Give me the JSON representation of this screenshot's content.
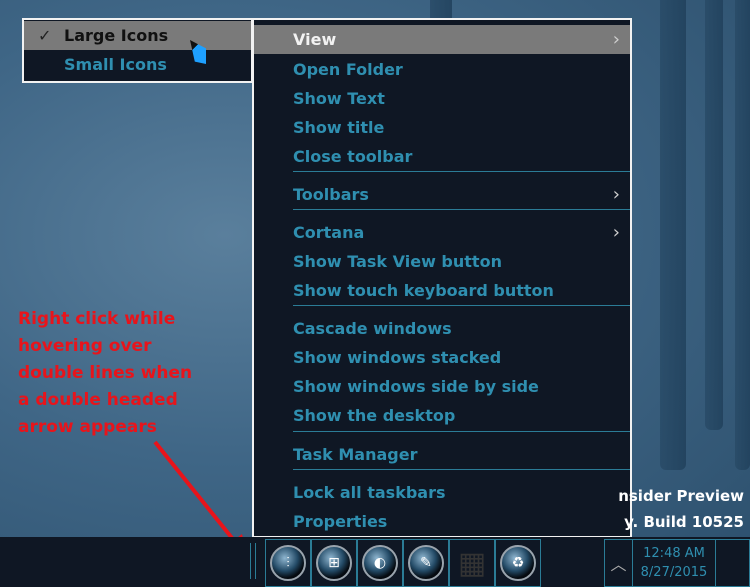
{
  "submenu": {
    "items": [
      {
        "label": "Large Icons",
        "checked": true,
        "highlighted": true
      },
      {
        "label": "Small Icons",
        "checked": false
      }
    ]
  },
  "menu": {
    "items": [
      {
        "label": "View",
        "arrow": true,
        "highlighted": true
      },
      {
        "label": "Open Folder"
      },
      {
        "label": "Show Text"
      },
      {
        "label": "Show title"
      },
      {
        "label": "Close toolbar"
      },
      {
        "label": "Toolbars",
        "arrow": true
      },
      {
        "label": "Cortana",
        "arrow": true
      },
      {
        "label": "Show Task View button"
      },
      {
        "label": "Show touch keyboard button"
      },
      {
        "label": "Cascade windows"
      },
      {
        "label": "Show windows stacked"
      },
      {
        "label": "Show windows side by side"
      },
      {
        "label": "Show the desktop"
      },
      {
        "label": "Task Manager"
      },
      {
        "label": "Lock all taskbars"
      },
      {
        "label": "Properties"
      }
    ]
  },
  "annotation": [
    "Right click while",
    "hovering over",
    "double lines when",
    "a double headed",
    "arrow appears"
  ],
  "watermark": {
    "line1": "nsider Preview",
    "line2": "y. Build 10525"
  },
  "taskbar": {
    "icons": [
      "equalizer-icon",
      "windows-icon",
      "firefox-icon",
      "edit-icon",
      "blocks-icon",
      "recycle-bin-icon"
    ],
    "clock": {
      "time": "12:48 AM",
      "date": "8/27/2015"
    }
  },
  "colors": {
    "menu_bg": "#0f1724",
    "menu_text": "#2f8fb0",
    "highlight": "#7a7a7a",
    "annotation": "#e8141b"
  }
}
